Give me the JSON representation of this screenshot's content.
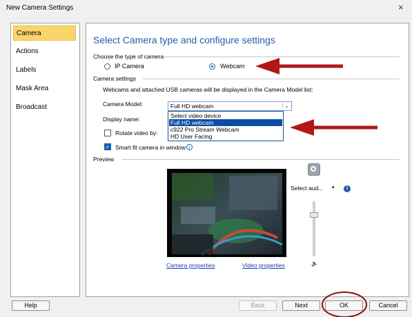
{
  "window": {
    "title": "New Camera Settings",
    "close": "×"
  },
  "sidebar": {
    "items": [
      {
        "label": "Camera",
        "selected": true
      },
      {
        "label": "Actions"
      },
      {
        "label": "Labels"
      },
      {
        "label": "Mask Area"
      },
      {
        "label": "Broadcast"
      }
    ]
  },
  "main": {
    "heading": "Select Camera type and configure settings",
    "camera_type": {
      "group_label": "Choose the type of camera",
      "options": [
        {
          "label": "IP Camera",
          "checked": false
        },
        {
          "label": "Webcam",
          "checked": true
        }
      ]
    },
    "camera_settings": {
      "group_label": "Camera settings",
      "description": "Webcams and attached USB cameras will be displayed in the Camera Model list:",
      "model_label": "Camera Model:",
      "model_value": "Full HD webcam",
      "model_options": [
        "Select video device",
        "Full HD webcam",
        "c922 Pro Stream Webcam",
        "HD User Facing"
      ],
      "display_name_label": "Display name:",
      "rotate_label": "Rotate video by:",
      "rotate_checked": false,
      "smart_fit_label": "Smart fit camera in window",
      "smart_fit_checked": true
    },
    "preview": {
      "group_label": "Preview",
      "audio_select": "Select aud...",
      "camera_properties_link": "Camera properties",
      "video_properties_link": "Video properties",
      "volume_level": 0.75
    }
  },
  "footer": {
    "help": "Help",
    "back": "Back",
    "next": "Next",
    "ok": "OK",
    "cancel": "Cancel"
  },
  "colors": {
    "accent": "#1f5fa8",
    "selected_sidebar": "#fbd56b",
    "annotation_red": "#b01818"
  }
}
